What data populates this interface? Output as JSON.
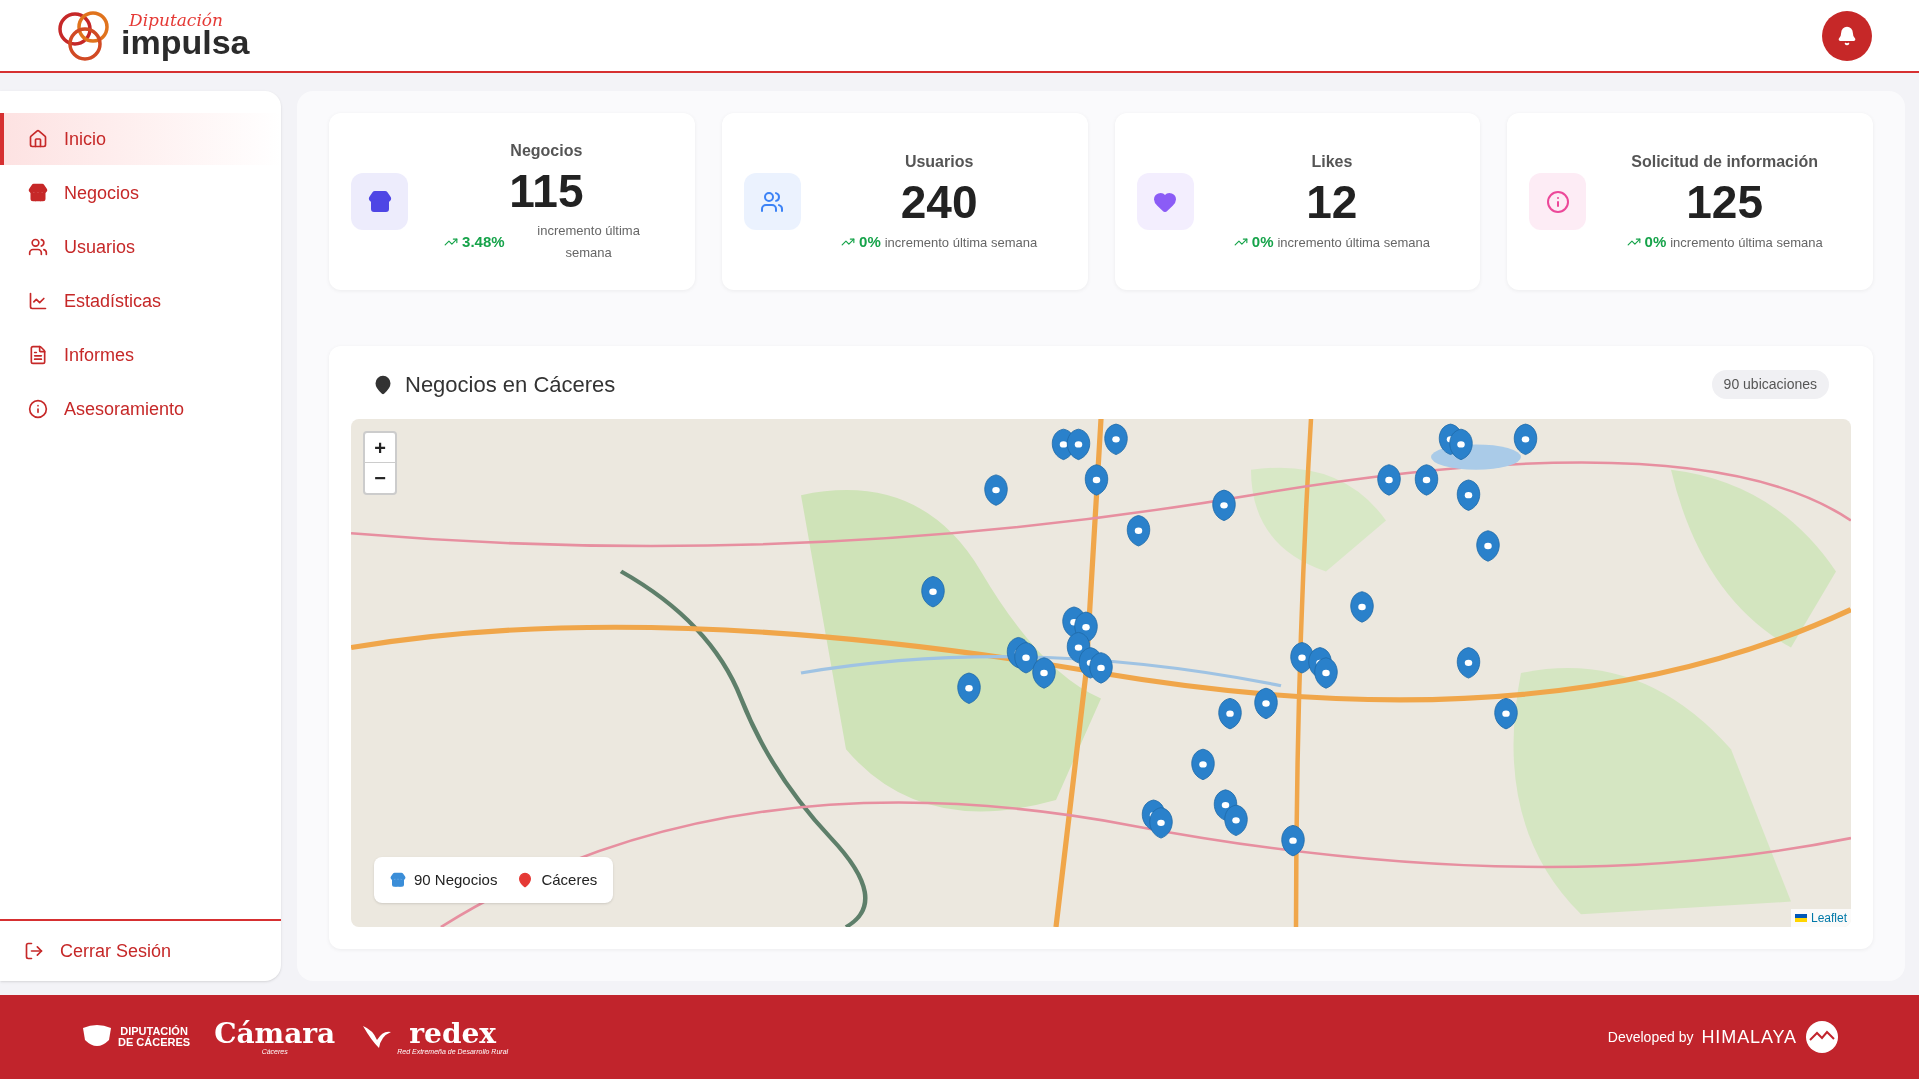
{
  "header": {
    "logo_script": "Diputación",
    "logo_word": "impulsa"
  },
  "sidebar": {
    "items": [
      {
        "label": "Inicio",
        "selected": true
      },
      {
        "label": "Negocios",
        "selected": false
      },
      {
        "label": "Usuarios",
        "selected": false
      },
      {
        "label": "Estadísticas",
        "selected": false
      },
      {
        "label": "Informes",
        "selected": false
      },
      {
        "label": "Asesoramiento",
        "selected": false
      }
    ],
    "logout": "Cerrar Sesión"
  },
  "stats": [
    {
      "title": "Negocios",
      "value": "115",
      "change": "3.48%",
      "note": "incremento última semana",
      "color": "#4f46e5"
    },
    {
      "title": "Usuarios",
      "value": "240",
      "change": "0%",
      "note": "incremento última semana",
      "color": "#3b82f6"
    },
    {
      "title": "Likes",
      "value": "12",
      "change": "0%",
      "note": "incremento última semana",
      "color": "#8b5cf6"
    },
    {
      "title": "Solicitud de información",
      "value": "125",
      "change": "0%",
      "note": "incremento última semana",
      "color": "#ec4899"
    }
  ],
  "map_card": {
    "title": "Negocios en Cáceres",
    "count": "90 ubicaciones",
    "zoom_in": "+",
    "zoom_out": "−",
    "legend": {
      "businesses": "90 Negocios",
      "place": "Cáceres"
    },
    "attribution": "Leaflet"
  },
  "footer": {
    "logos": [
      {
        "line1": "DIPUTACIÓN",
        "line2": "DE CÁCERES"
      },
      {
        "line1": "Cámara",
        "line2": "Cáceres"
      },
      {
        "line1": "redex",
        "line2": "Red Extremeña de Desarrollo Rural"
      }
    ],
    "developed_by": "Developed by",
    "company": "HIMALAYA"
  }
}
